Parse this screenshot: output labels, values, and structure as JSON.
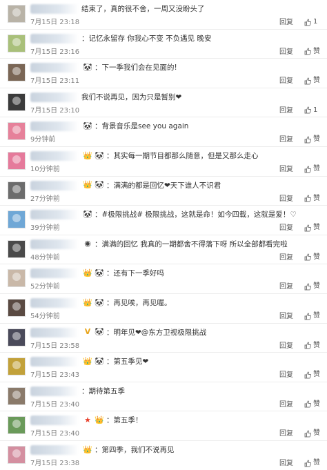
{
  "reply_label": "回复",
  "comments": [
    {
      "badges": [],
      "text": "结束了，真的很不舍，一周又没盼头了",
      "time": "7月15日 23:18",
      "like": "1",
      "avatar_color": "#b9b3a7"
    },
    {
      "badges": [],
      "text": "：记忆永留存 你我心不变 不负遇见 晚安",
      "time": "7月15日 23:16",
      "like": "赞",
      "avatar_color": "#a9c07a"
    },
    {
      "badges": [
        "panda"
      ],
      "text": "：下一季我们会在见面的!",
      "time": "7月15日 23:11",
      "like": "赞",
      "avatar_color": "#7a6655"
    },
    {
      "badges": [],
      "text": "我们不说再见，因为只是暂别❤",
      "time": "7月15日 23:10",
      "like": "1",
      "avatar_color": "#3b3b3b"
    },
    {
      "badges": [
        "panda"
      ],
      "text": "：背景音乐是see you again",
      "time": "9分钟前",
      "like": "赞",
      "avatar_color": "#e6819a"
    },
    {
      "badges": [
        "crown",
        "panda"
      ],
      "text": "：其实每一期节目都那么随意，但是又那么走心",
      "time": "10分钟前",
      "like": "赞",
      "avatar_color": "#e57a9b"
    },
    {
      "badges": [
        "crown",
        "panda"
      ],
      "text": "：满满的都是回忆❤天下谁人不识君",
      "time": "27分钟前",
      "like": "赞",
      "avatar_color": "#6c6c6c"
    },
    {
      "badges": [
        "panda"
      ],
      "text": "：#极限挑战# 极限挑战，这就是命！如今四载，这就是爱！♡",
      "time": "39分钟前",
      "like": "赞",
      "avatar_color": "#6fa7d6"
    },
    {
      "badges": [
        "dark"
      ],
      "text": "：满满的回忆 我真的一期都舍不得落下呀 所以全部都看完啦",
      "time": "48分钟前",
      "like": "赞",
      "avatar_color": "#4a4a4a"
    },
    {
      "badges": [
        "crown",
        "panda"
      ],
      "text": "：还有下一季好吗",
      "time": "52分钟前",
      "like": "赞",
      "avatar_color": "#c9b8a8"
    },
    {
      "badges": [
        "crown",
        "panda"
      ],
      "text": "：再见唉，再见喔。",
      "time": "54分钟前",
      "like": "赞",
      "avatar_color": "#5a4a42"
    },
    {
      "badges": [
        "v",
        "panda"
      ],
      "text": "：明年见❤@东方卫视极限挑战",
      "time": "7月15日 23:58",
      "like": "赞",
      "avatar_color": "#4a4a5a"
    },
    {
      "badges": [
        "crown",
        "panda"
      ],
      "text": "：第五季见❤",
      "time": "7月15日 23:43",
      "like": "赞",
      "avatar_color": "#c2a13a"
    },
    {
      "badges": [],
      "text": "：期待第五季",
      "time": "7月15日 23:40",
      "like": "赞",
      "avatar_color": "#8a7a6a"
    },
    {
      "badges": [
        "star",
        "crown"
      ],
      "text": "：第五季！",
      "time": "7月15日 23:40",
      "like": "赞",
      "avatar_color": "#6a9a5a"
    },
    {
      "badges": [
        "crown"
      ],
      "text": "：第四季，我们不说再见",
      "time": "7月15日 23:38",
      "like": "赞",
      "avatar_color": "#d48fa0"
    }
  ]
}
